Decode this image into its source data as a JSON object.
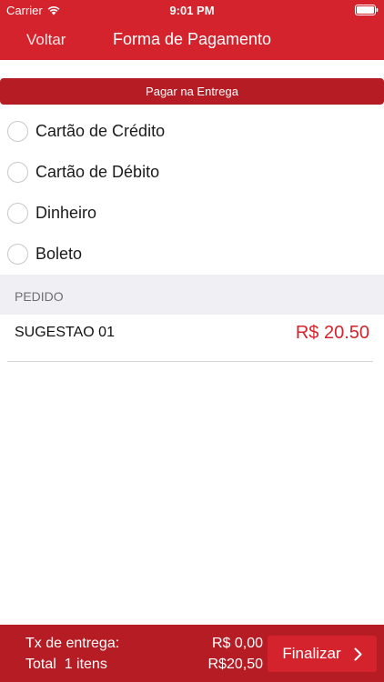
{
  "status_bar": {
    "carrier": "Carrier",
    "time": "9:01 PM",
    "wifi_icon": "wifi-icon",
    "battery_icon": "battery-icon"
  },
  "nav": {
    "back_label": "Voltar",
    "title": "Forma de Pagamento"
  },
  "payment": {
    "section_label": "Pagar na Entrega",
    "options": [
      {
        "label": "Cartão de Crédito",
        "selected": false
      },
      {
        "label": "Cartão de Débito",
        "selected": false
      },
      {
        "label": "Dinheiro",
        "selected": false
      },
      {
        "label": "Boleto",
        "selected": false
      }
    ]
  },
  "order": {
    "header": "PEDIDO",
    "items": [
      {
        "name": "SUGESTAO 01",
        "price": "R$ 20.50"
      }
    ]
  },
  "footer": {
    "fee_label": "Tx de entrega:",
    "fee_value": "R$ 0,00",
    "total_label": "Total  1 itens",
    "total_value": "R$20,50",
    "finalize_label": "Finalizar",
    "finalize_icon": "chevron-right-icon"
  },
  "colors": {
    "brand_red": "#d4232c",
    "dark_red": "#b51c24",
    "section_gray": "#efeff4"
  }
}
